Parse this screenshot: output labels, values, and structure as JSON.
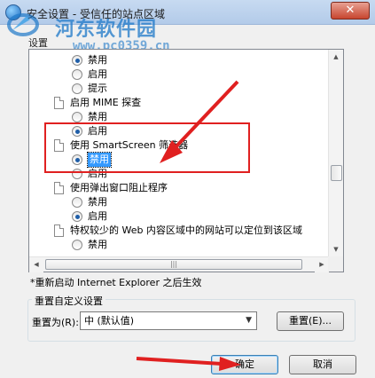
{
  "window": {
    "title": "安全设置 - 受信任的站点区域",
    "close_glyph": "✕"
  },
  "watermark": {
    "brand": "河东软件园",
    "url": "www.pc0359.cn"
  },
  "settings_label": "设置",
  "settings_list": [
    {
      "kind": "radio",
      "label": "禁用",
      "selected": true,
      "indent": 1
    },
    {
      "kind": "radio",
      "label": "启用",
      "selected": false,
      "indent": 1
    },
    {
      "kind": "radio",
      "label": "提示",
      "selected": false,
      "indent": 1
    },
    {
      "kind": "header",
      "label": "启用 MIME 探查",
      "indent": 0
    },
    {
      "kind": "radio",
      "label": "禁用",
      "selected": false,
      "indent": 1
    },
    {
      "kind": "radio",
      "label": "启用",
      "selected": true,
      "indent": 1
    },
    {
      "kind": "header",
      "label": "使用 SmartScreen 筛选器",
      "indent": 0
    },
    {
      "kind": "radio",
      "label": "禁用",
      "selected": true,
      "indent": 1,
      "highlight": true
    },
    {
      "kind": "radio",
      "label": "启用",
      "selected": false,
      "indent": 1
    },
    {
      "kind": "header",
      "label": "使用弹出窗口阻止程序",
      "indent": 0
    },
    {
      "kind": "radio",
      "label": "禁用",
      "selected": false,
      "indent": 1
    },
    {
      "kind": "radio",
      "label": "启用",
      "selected": true,
      "indent": 1
    },
    {
      "kind": "header",
      "label": "特权较少的 Web 内容区域中的网站可以定位到该区域",
      "indent": 0
    },
    {
      "kind": "radio",
      "label": "禁用",
      "selected": false,
      "indent": 1
    }
  ],
  "note": "*重新启动 Internet Explorer 之后生效",
  "reset_group": {
    "title": "重置自定义设置",
    "reset_to_label": "重置为(R):",
    "selected_level": "中 (默认值)",
    "reset_button": "重置(E)..."
  },
  "buttons": {
    "ok": "确定",
    "cancel": "取消"
  },
  "colors": {
    "selection": "#3399ff",
    "annotation_red": "#e02020"
  }
}
